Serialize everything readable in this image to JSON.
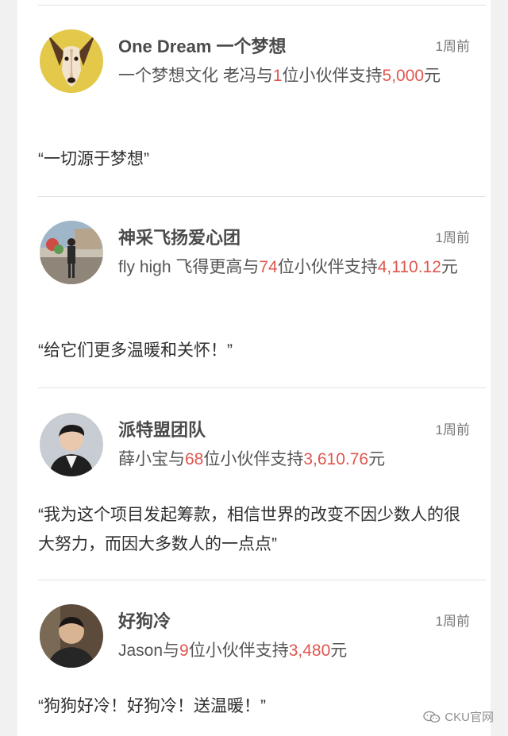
{
  "feed": [
    {
      "name": "One Dream 一个梦想",
      "time": "1周前",
      "support_prefix": "一个梦想文化 老冯与",
      "backer_count": "1",
      "support_mid": "位小伙伴支持",
      "amount": "5,000",
      "support_suffix": "元",
      "quote": "“一切源于梦想”",
      "avatar_icon": "dog-portrait-avatar"
    },
    {
      "name": "神采飞扬爱心团",
      "time": "1周前",
      "support_prefix": "fly high 飞得更高与",
      "backer_count": "74",
      "support_mid": "位小伙伴支持",
      "amount": "4,110.12",
      "support_suffix": "元",
      "quote": "“给它们更多温暖和关怀！”",
      "avatar_icon": "person-outdoor-avatar"
    },
    {
      "name": "派特盟团队",
      "time": "1周前",
      "support_prefix": "薛小宝与",
      "backer_count": "68",
      "support_mid": "位小伙伴支持",
      "amount": "3,610.76",
      "support_suffix": "元",
      "quote": "“我为这个项目发起筹款，相信世界的改变不因少数人的很大努力，而因大多数人的一点点”",
      "avatar_icon": "person-portrait-avatar"
    },
    {
      "name": "好狗冷",
      "time": "1周前",
      "support_prefix": "Jason与",
      "backer_count": "9",
      "support_mid": "位小伙伴支持",
      "amount": "3,480",
      "support_suffix": "元",
      "quote": "“狗狗好冷！好狗冷！送温暖！”",
      "avatar_icon": "man-portrait-avatar"
    }
  ],
  "watermark": {
    "text": "CKU官网",
    "icon": "wechat-icon"
  },
  "colors": {
    "highlight": "#e0564f",
    "page_background": "#f1f1f1",
    "card_background": "#ffffff"
  }
}
